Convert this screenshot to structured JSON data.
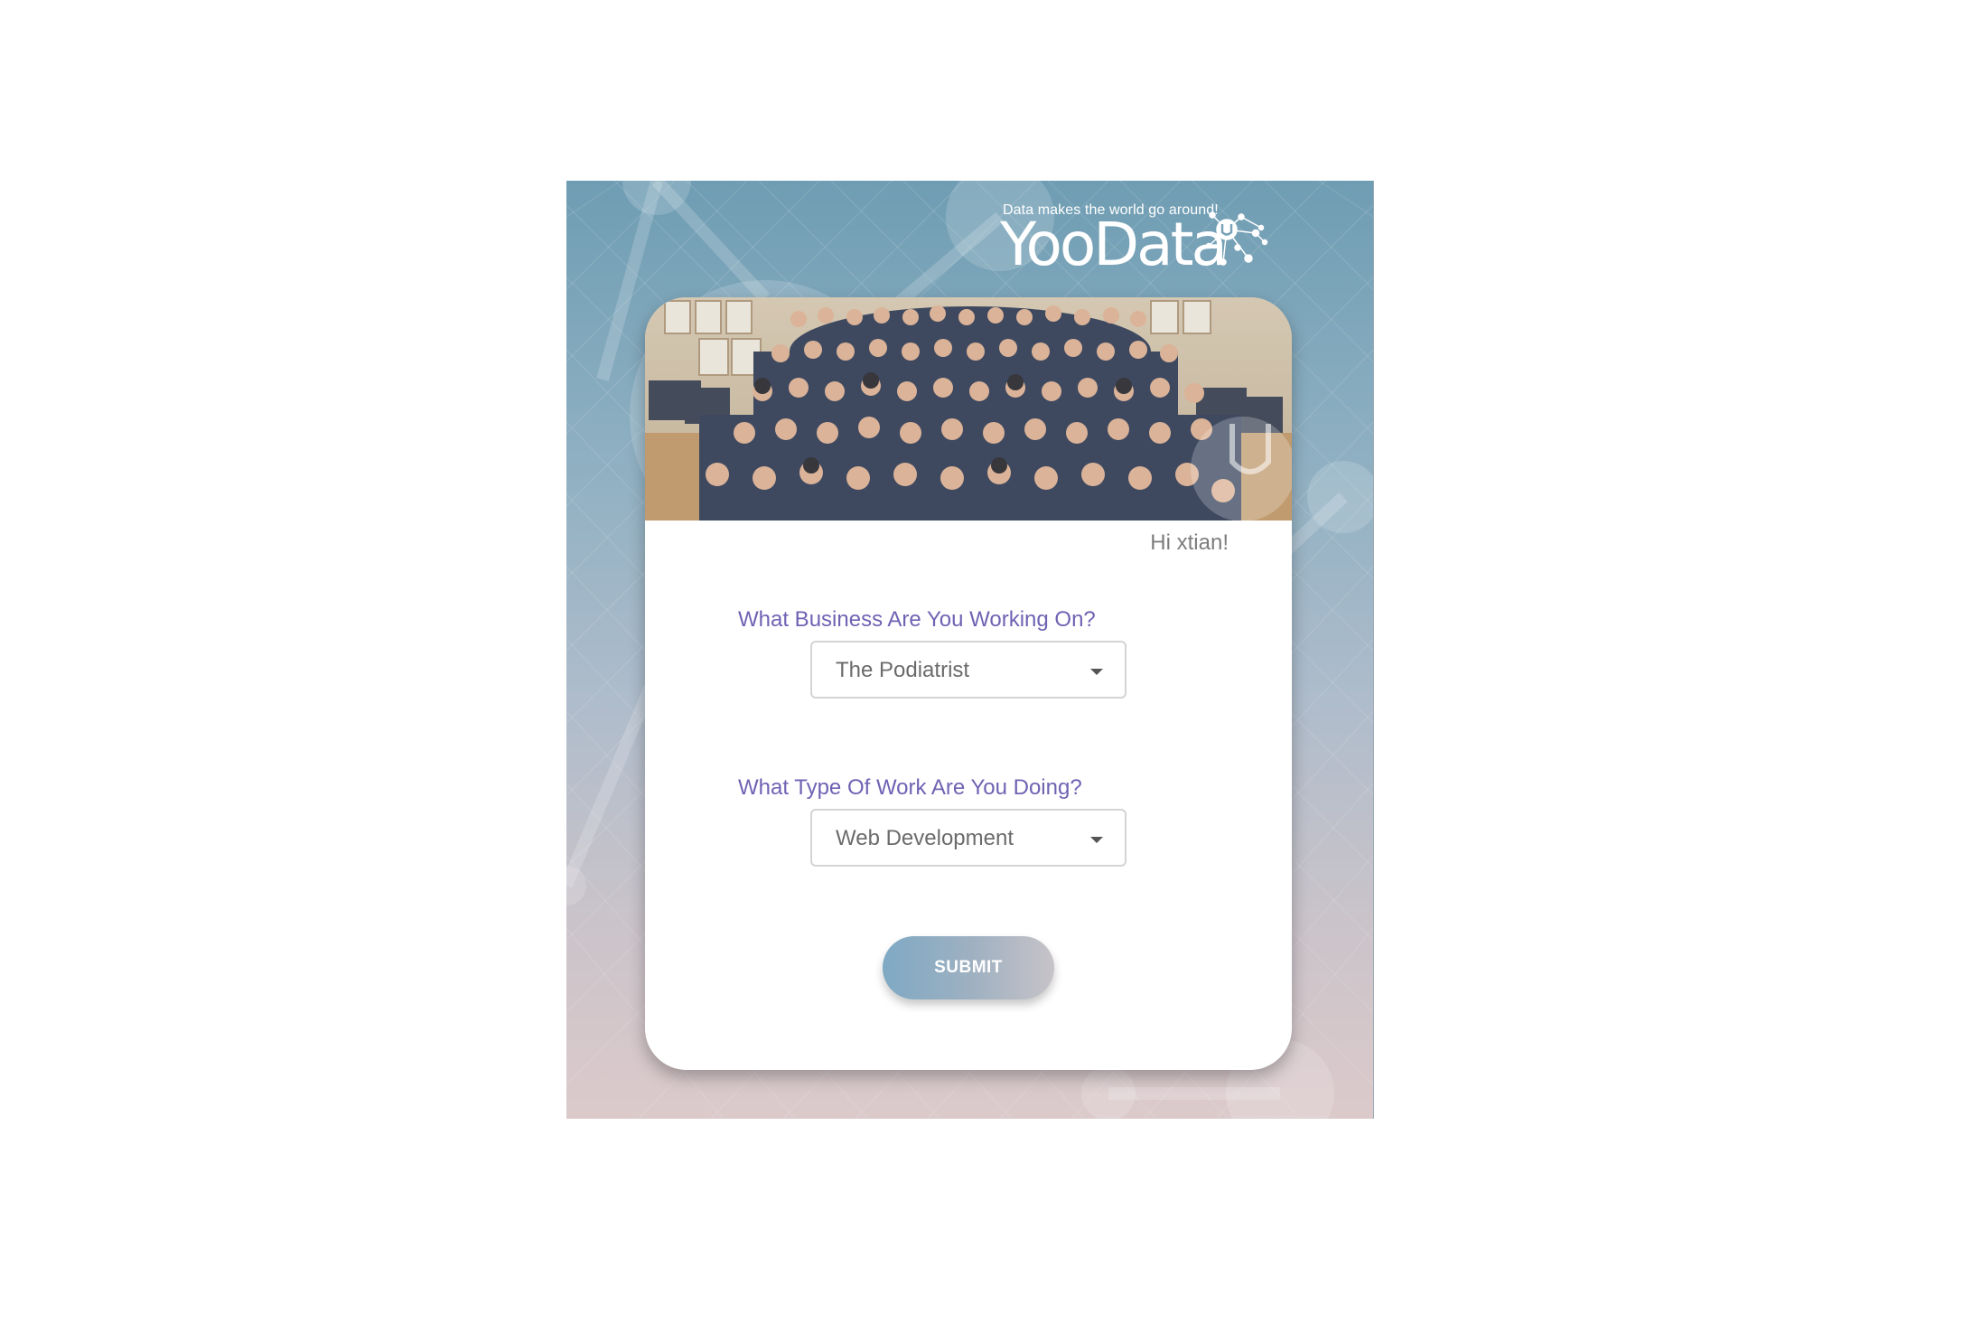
{
  "header": {
    "tagline": "Data makes the world go around!",
    "brand_name": "YooData"
  },
  "form": {
    "greeting": "Hi xtian!",
    "business_question": "What Business Are You Working On?",
    "business_selected": "The Podiatrist",
    "work_question": "What Type Of Work Are You Doing?",
    "work_selected": "Web Development",
    "submit_label": "SUBMIT"
  },
  "colors": {
    "question_text": "#6e63b3",
    "panel_top": "#6f9db3",
    "panel_bottom": "#dccacb",
    "submit_gradient_start": "#7fa9c4",
    "submit_gradient_end": "#c7c3c8"
  },
  "icons": {
    "logo": "network-dots-icon",
    "dropdown": "caret-down-icon"
  }
}
